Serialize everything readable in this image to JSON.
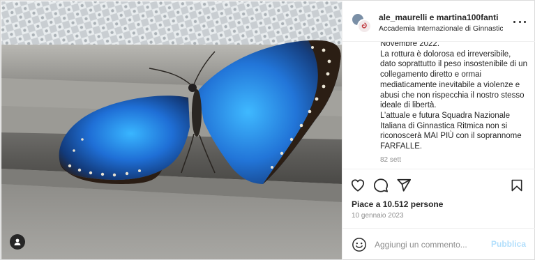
{
  "post": {
    "usernames": "ale_maurelli e martina100fanti",
    "location": "Accademia Internazionale di Ginnastica",
    "caption": "Novembre 2022.\nLa rottura è dolorosa ed irreversibile, dato soprattutto il peso insostenibile di un collegamento diretto e ormai mediaticamente inevitabile a violenze e abusi che non rispecchia il nostro stesso ideale di libertà.\nL’attuale e futura Squadra Nazionale Italiana di Ginnastica Ritmica non si riconoscerà MAI PIÙ con il soprannome FARFALLE.",
    "caption_age": "82 sett",
    "likes": "Piace a 10.512 persone",
    "date": "10 gennaio 2023"
  },
  "comment": {
    "placeholder": "Aggiungi un commento...",
    "post_label": "Pubblica"
  },
  "icons": {
    "like": "heart-icon",
    "comment": "comment-icon",
    "share": "send-icon",
    "save": "bookmark-icon",
    "more": "more-options-icon",
    "emoji": "emoji-icon",
    "user_tag": "user-tag-icon"
  },
  "colors": {
    "text": "#262626",
    "muted": "#8e8e8e",
    "post_button_disabled": "#b2dffc",
    "border": "#efefef"
  }
}
